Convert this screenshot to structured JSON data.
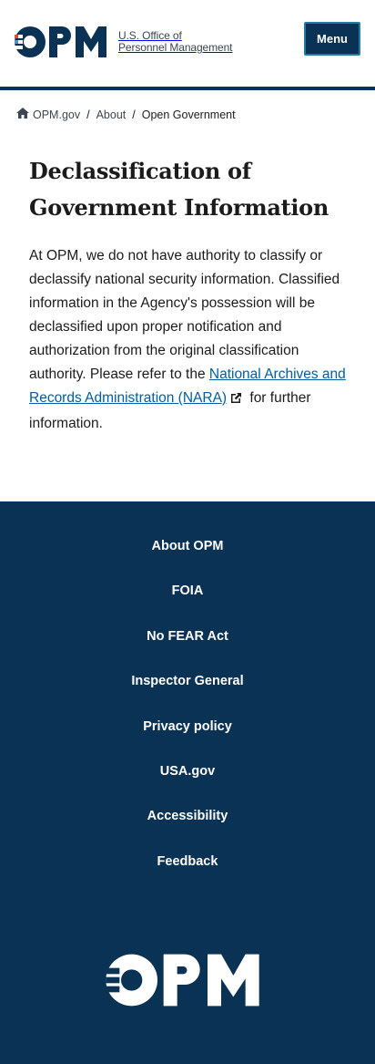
{
  "header": {
    "logo_text": "OPM",
    "logo_line1": "U.S. Office of",
    "logo_line2": "Personnel Management",
    "menu_label": "Menu"
  },
  "breadcrumb": {
    "items": [
      {
        "label": "OPM.gov"
      },
      {
        "label": "About"
      },
      {
        "label": "Open Government"
      }
    ],
    "separator": "/"
  },
  "page": {
    "title_line1": "Declassification of",
    "title_line2": "Government Information",
    "paragraph_before_link": "At OPM, we do not have authority to classify or declassify national security information. Classified information in the Agency's possession will be declassified upon proper notification and authorization from the original classification authority. Please refer to the ",
    "link_text": "National Archives and Records Administration (NARA)",
    "paragraph_after_link": " for further information."
  },
  "footer": {
    "links": [
      {
        "label": "About OPM"
      },
      {
        "label": "FOIA"
      },
      {
        "label": "No FEAR Act"
      },
      {
        "label": "Inspector General"
      },
      {
        "label": "Privacy policy"
      },
      {
        "label": "USA.gov"
      },
      {
        "label": "Accessibility"
      },
      {
        "label": "Feedback"
      }
    ],
    "logo_text": "OPM"
  },
  "colors": {
    "navy": "#0a3254",
    "link_blue": "#005ea2",
    "accent_teal": "#1f7ea0",
    "logo_red": "#e0493b",
    "logo_blue": "#3a9bd5"
  },
  "icons": {
    "home": "home-icon",
    "external_link": "external-link-icon"
  }
}
